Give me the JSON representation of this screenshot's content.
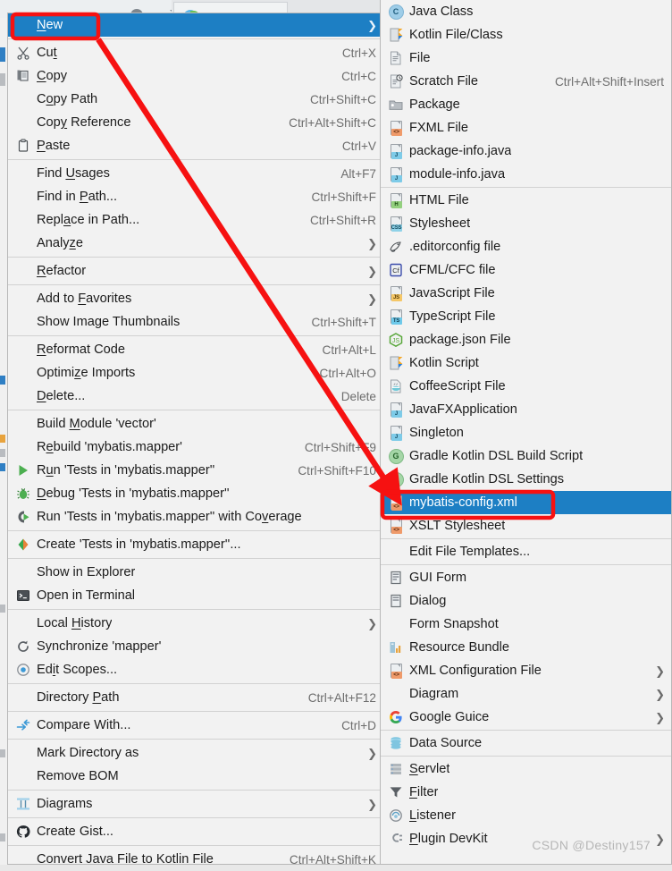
{
  "window": {
    "watermark": "CSDN @Destiny157"
  },
  "context_menu": {
    "name": "project-view-context-menu",
    "groups": [
      {
        "items": [
          {
            "label": "New",
            "accel": "",
            "icon": "",
            "submenu": true,
            "selected": true,
            "mnemonic": "N"
          }
        ]
      },
      {
        "items": [
          {
            "label": "Cut",
            "accel": "Ctrl+X",
            "icon": "scissors-icon",
            "submenu": false,
            "mnemonic": "t"
          },
          {
            "label": "Copy",
            "accel": "Ctrl+C",
            "icon": "copy-icon",
            "submenu": false,
            "mnemonic": "C"
          },
          {
            "label": "Copy Path",
            "accel": "Ctrl+Shift+C",
            "icon": "",
            "submenu": false,
            "mnemonic": "o"
          },
          {
            "label": "Copy Reference",
            "accel": "Ctrl+Alt+Shift+C",
            "icon": "",
            "submenu": false,
            "mnemonic": "y"
          },
          {
            "label": "Paste",
            "accel": "Ctrl+V",
            "icon": "clipboard-icon",
            "submenu": false,
            "mnemonic": "P"
          }
        ]
      },
      {
        "items": [
          {
            "label": "Find Usages",
            "accel": "Alt+F7",
            "icon": "",
            "submenu": false,
            "mnemonic": "U"
          },
          {
            "label": "Find in Path...",
            "accel": "Ctrl+Shift+F",
            "icon": "",
            "submenu": false,
            "mnemonic": "P"
          },
          {
            "label": "Replace in Path...",
            "accel": "Ctrl+Shift+R",
            "icon": "",
            "submenu": false,
            "mnemonic": "a"
          },
          {
            "label": "Analyze",
            "accel": "",
            "icon": "",
            "submenu": true,
            "mnemonic": "z"
          }
        ]
      },
      {
        "items": [
          {
            "label": "Refactor",
            "accel": "",
            "icon": "",
            "submenu": true,
            "mnemonic": "R"
          }
        ]
      },
      {
        "items": [
          {
            "label": "Add to Favorites",
            "accel": "",
            "icon": "",
            "submenu": true,
            "mnemonic": "F"
          },
          {
            "label": "Show Image Thumbnails",
            "accel": "Ctrl+Shift+T",
            "icon": "",
            "submenu": false
          }
        ]
      },
      {
        "items": [
          {
            "label": "Reformat Code",
            "accel": "Ctrl+Alt+L",
            "icon": "",
            "submenu": false,
            "mnemonic": "R"
          },
          {
            "label": "Optimize Imports",
            "accel": "Ctrl+Alt+O",
            "icon": "",
            "submenu": false,
            "mnemonic": "z"
          },
          {
            "label": "Delete...",
            "accel": "Delete",
            "icon": "",
            "submenu": false,
            "mnemonic": "D"
          }
        ]
      },
      {
        "items": [
          {
            "label": "Build Module 'vector'",
            "accel": "",
            "icon": "",
            "submenu": false,
            "mnemonic": "M"
          },
          {
            "label": "Rebuild 'mybatis.mapper'",
            "accel": "Ctrl+Shift+F9",
            "icon": "",
            "submenu": false,
            "mnemonic": "e"
          },
          {
            "label": "Run 'Tests in 'mybatis.mapper''",
            "accel": "Ctrl+Shift+F10",
            "icon": "run-icon",
            "submenu": false,
            "mnemonic": "u"
          },
          {
            "label": "Debug 'Tests in 'mybatis.mapper''",
            "accel": "",
            "icon": "debug-icon",
            "submenu": false,
            "mnemonic": "D"
          },
          {
            "label": "Run 'Tests in 'mybatis.mapper'' with Coverage",
            "accel": "",
            "icon": "coverage-icon",
            "submenu": false,
            "mnemonic": "v"
          }
        ]
      },
      {
        "items": [
          {
            "label": "Create 'Tests in 'mybatis.mapper''...",
            "accel": "",
            "icon": "create-config-icon",
            "submenu": false
          }
        ]
      },
      {
        "items": [
          {
            "label": "Show in Explorer",
            "accel": "",
            "icon": "",
            "submenu": false
          },
          {
            "label": "Open in Terminal",
            "accel": "",
            "icon": "terminal-icon",
            "submenu": false
          }
        ]
      },
      {
        "items": [
          {
            "label": "Local History",
            "accel": "",
            "icon": "",
            "submenu": true,
            "mnemonic": "H"
          },
          {
            "label": "Synchronize 'mapper'",
            "accel": "",
            "icon": "refresh-icon",
            "submenu": false
          },
          {
            "label": "Edit Scopes...",
            "accel": "",
            "icon": "scopes-icon",
            "submenu": false,
            "mnemonic": "i"
          }
        ]
      },
      {
        "items": [
          {
            "label": "Directory Path",
            "accel": "Ctrl+Alt+F12",
            "icon": "",
            "submenu": false,
            "mnemonic": "P"
          }
        ]
      },
      {
        "items": [
          {
            "label": "Compare With...",
            "accel": "Ctrl+D",
            "icon": "compare-icon",
            "submenu": false
          }
        ]
      },
      {
        "items": [
          {
            "label": "Mark Directory as",
            "accel": "",
            "icon": "",
            "submenu": true
          },
          {
            "label": "Remove BOM",
            "accel": "",
            "icon": "",
            "submenu": false
          }
        ]
      },
      {
        "items": [
          {
            "label": "Diagrams",
            "accel": "",
            "icon": "diagram-icon",
            "submenu": true
          }
        ]
      },
      {
        "items": [
          {
            "label": "Create Gist...",
            "accel": "",
            "icon": "github-icon",
            "submenu": false
          }
        ]
      },
      {
        "items": [
          {
            "label": "Convert Java File to Kotlin File",
            "accel": "Ctrl+Alt+Shift+K",
            "icon": "",
            "submenu": false
          }
        ]
      }
    ]
  },
  "new_submenu": {
    "name": "new-file-submenu",
    "groups": [
      {
        "items": [
          {
            "label": "Java Class",
            "accel": "",
            "icon": "java-class-icon",
            "submenu": false
          },
          {
            "label": "Kotlin File/Class",
            "accel": "",
            "icon": "kotlin-file-icon",
            "submenu": false
          },
          {
            "label": "File",
            "accel": "",
            "icon": "plain-file-icon",
            "submenu": false
          },
          {
            "label": "Scratch File",
            "accel": "Ctrl+Alt+Shift+Insert",
            "icon": "scratch-file-icon",
            "submenu": false
          },
          {
            "label": "Package",
            "accel": "",
            "icon": "package-icon",
            "submenu": false
          },
          {
            "label": "FXML File",
            "accel": "",
            "icon": "fxml-file-icon",
            "submenu": false
          },
          {
            "label": "package-info.java",
            "accel": "",
            "icon": "java-file-icon",
            "submenu": false
          },
          {
            "label": "module-info.java",
            "accel": "",
            "icon": "java-file-icon",
            "submenu": false
          }
        ]
      },
      {
        "items": [
          {
            "label": "HTML File",
            "accel": "",
            "icon": "html-file-icon",
            "submenu": false
          },
          {
            "label": "Stylesheet",
            "accel": "",
            "icon": "css-file-icon",
            "submenu": false
          },
          {
            "label": ".editorconfig file",
            "accel": "",
            "icon": "editorconfig-icon",
            "submenu": false
          },
          {
            "label": "CFML/CFC file",
            "accel": "",
            "icon": "cfml-file-icon",
            "submenu": false
          },
          {
            "label": "JavaScript File",
            "accel": "",
            "icon": "javascript-file-icon",
            "submenu": false
          },
          {
            "label": "TypeScript File",
            "accel": "",
            "icon": "typescript-file-icon",
            "submenu": false
          },
          {
            "label": "package.json File",
            "accel": "",
            "icon": "nodejs-icon",
            "submenu": false
          },
          {
            "label": "Kotlin Script",
            "accel": "",
            "icon": "kotlin-script-icon",
            "submenu": false
          },
          {
            "label": "CoffeeScript File",
            "accel": "",
            "icon": "coffeescript-icon",
            "submenu": false
          },
          {
            "label": "JavaFXApplication",
            "accel": "",
            "icon": "java-file-icon",
            "submenu": false
          },
          {
            "label": "Singleton",
            "accel": "",
            "icon": "java-file-icon",
            "submenu": false
          },
          {
            "label": "Gradle Kotlin DSL Build Script",
            "accel": "",
            "icon": "gradle-icon",
            "submenu": false
          },
          {
            "label": "Gradle Kotlin DSL Settings",
            "accel": "",
            "icon": "gradle-icon",
            "submenu": false
          },
          {
            "label": "mybatis-config.xml",
            "accel": "",
            "icon": "xml-file-icon",
            "submenu": false,
            "selected": true,
            "highlighted": true
          },
          {
            "label": "XSLT Stylesheet",
            "accel": "",
            "icon": "xml-file-icon",
            "submenu": false
          }
        ]
      },
      {
        "items": [
          {
            "label": "Edit File Templates...",
            "accel": "",
            "icon": "",
            "submenu": false
          }
        ]
      },
      {
        "items": [
          {
            "label": "GUI Form",
            "accel": "",
            "icon": "gui-form-icon",
            "submenu": false
          },
          {
            "label": "Dialog",
            "accel": "",
            "icon": "dialog-icon",
            "submenu": false
          },
          {
            "label": "Form Snapshot",
            "accel": "",
            "icon": "",
            "submenu": false
          },
          {
            "label": "Resource Bundle",
            "accel": "",
            "icon": "resource-bundle-icon",
            "submenu": false
          },
          {
            "label": "XML Configuration File",
            "accel": "",
            "icon": "xml-file-icon",
            "submenu": true
          },
          {
            "label": "Diagram",
            "accel": "",
            "icon": "",
            "submenu": true
          },
          {
            "label": "Google Guice",
            "accel": "",
            "icon": "google-icon",
            "submenu": true
          }
        ]
      },
      {
        "items": [
          {
            "label": "Data Source",
            "accel": "",
            "icon": "data-source-icon",
            "submenu": false
          }
        ]
      },
      {
        "items": [
          {
            "label": "Servlet",
            "accel": "",
            "icon": "servlet-icon",
            "submenu": false,
            "mnemonic": "S"
          },
          {
            "label": "Filter",
            "accel": "",
            "icon": "filter-icon",
            "submenu": false,
            "mnemonic": "F"
          },
          {
            "label": "Listener",
            "accel": "",
            "icon": "listener-icon",
            "submenu": false,
            "mnemonic": "L"
          },
          {
            "label": "Plugin DevKit",
            "accel": "",
            "icon": "plugin-icon",
            "submenu": true,
            "mnemonic": "P"
          }
        ]
      }
    ]
  },
  "annotations": {
    "highlight_new": {
      "shape": "rounded-rect",
      "color": "#f61111"
    },
    "highlight_target": {
      "shape": "rounded-rect",
      "color": "#f61111",
      "label": "mybatis-config.xml"
    },
    "arrow": {
      "color": "#f61111",
      "from": "New",
      "to": "mybatis-config.xml"
    }
  },
  "colors": {
    "selection": "#1d7fc4",
    "menu_bg": "#f2f2f2",
    "annotation": "#f61111",
    "accel_text": "#6d6d6d"
  }
}
